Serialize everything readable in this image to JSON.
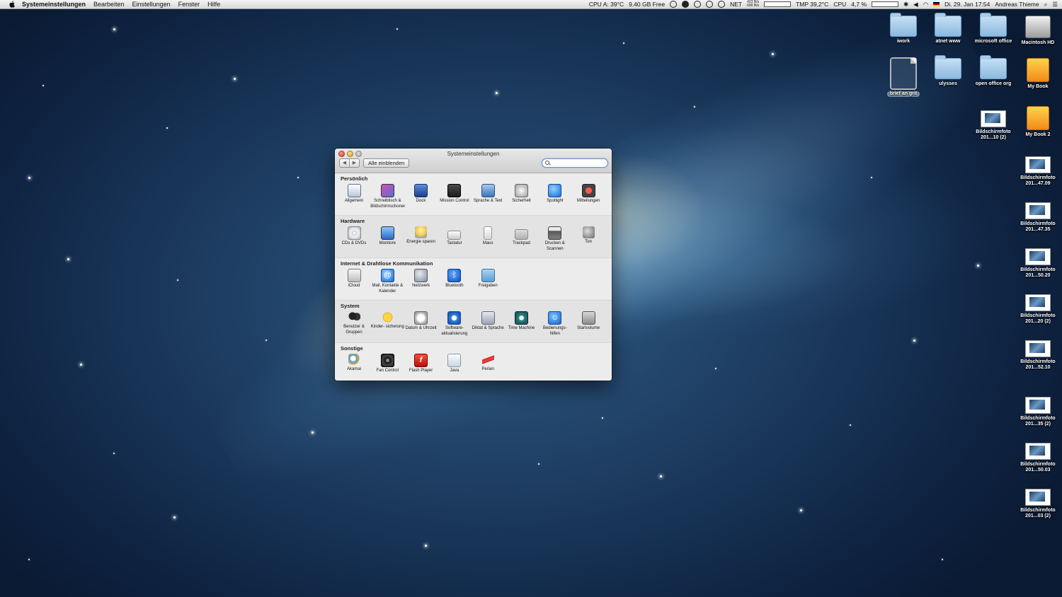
{
  "menubar": {
    "app_name": "Systemeinstellungen",
    "menus": [
      "Bearbeiten",
      "Einstellungen",
      "Fenster",
      "Hilfe"
    ],
    "status": {
      "cpu_temp": "CPU A: 39°C",
      "disk_free": "9.40 GB Free",
      "net": "NET",
      "net_up": "423 B/s",
      "net_down": "690 B/s",
      "tmp": "TMP 39,2°C",
      "cpu_label": "CPU",
      "cpu_percent": "4,7 %",
      "clock": "Di. 29. Jan  17:54",
      "user": "Andreas Thieme"
    }
  },
  "window": {
    "title": "Systemeinstellungen",
    "show_all": "Alle einblenden",
    "search_placeholder": "",
    "sections": [
      {
        "title": "Persönlich",
        "items": [
          {
            "label": "Allgemein",
            "icon": "general-icon"
          },
          {
            "label": "Schreibtisch & Bildschirmschoner",
            "icon": "desktop-icon"
          },
          {
            "label": "Dock",
            "icon": "dock-icon"
          },
          {
            "label": "Mission Control",
            "icon": "mission-control-icon"
          },
          {
            "label": "Sprache & Text",
            "icon": "language-icon"
          },
          {
            "label": "Sicherheit",
            "icon": "security-icon"
          },
          {
            "label": "Spotlight",
            "icon": "spotlight-icon"
          },
          {
            "label": "Mitteilungen",
            "icon": "notifications-icon"
          }
        ]
      },
      {
        "title": "Hardware",
        "items": [
          {
            "label": "CDs & DVDs",
            "icon": "cd-icon"
          },
          {
            "label": "Monitore",
            "icon": "monitor-icon"
          },
          {
            "label": "Energie sparen",
            "icon": "energy-icon"
          },
          {
            "label": "Tastatur",
            "icon": "keyboard-icon"
          },
          {
            "label": "Maus",
            "icon": "mouse-icon"
          },
          {
            "label": "Trackpad",
            "icon": "trackpad-icon"
          },
          {
            "label": "Drucken & Scannen",
            "icon": "printer-icon"
          },
          {
            "label": "Ton",
            "icon": "sound-icon"
          }
        ]
      },
      {
        "title": "Internet & Drahtlose Kommunikation",
        "items": [
          {
            "label": "iCloud",
            "icon": "icloud-icon"
          },
          {
            "label": "Mail, Kontakte & Kalender",
            "icon": "mail-icon"
          },
          {
            "label": "Netzwerk",
            "icon": "network-icon"
          },
          {
            "label": "Bluetooth",
            "icon": "bluetooth-icon"
          },
          {
            "label": "Freigaben",
            "icon": "sharing-icon"
          }
        ]
      },
      {
        "title": "System",
        "items": [
          {
            "label": "Benutzer & Gruppen",
            "icon": "users-icon"
          },
          {
            "label": "Kinder- sicherung",
            "icon": "parental-controls-icon"
          },
          {
            "label": "Datum & Uhrzeit",
            "icon": "clock-icon"
          },
          {
            "label": "Software- aktualisierung",
            "icon": "software-update-icon"
          },
          {
            "label": "Diktat & Sprache",
            "icon": "dictation-icon"
          },
          {
            "label": "Time Machine",
            "icon": "time-machine-icon"
          },
          {
            "label": "Bedienungs- hilfen",
            "icon": "accessibility-icon"
          },
          {
            "label": "Startvolume",
            "icon": "startup-disk-icon"
          }
        ]
      },
      {
        "title": "Sonstige",
        "items": [
          {
            "label": "Akamai",
            "icon": "akamai-icon"
          },
          {
            "label": "Fan Control",
            "icon": "fan-icon"
          },
          {
            "label": "Flash Player",
            "icon": "flash-icon"
          },
          {
            "label": "Java",
            "icon": "java-icon"
          },
          {
            "label": "Perian",
            "icon": "perian-icon"
          }
        ]
      }
    ]
  },
  "desktop_icons": [
    {
      "label": "iwork",
      "type": "folder-icon"
    },
    {
      "label": "atnet www",
      "type": "folder-icon"
    },
    {
      "label": "microsoft office",
      "type": "folder-icon"
    },
    {
      "label": "Macintosh HD",
      "type": "hard-drive-icon"
    },
    {
      "label": "brief an grit",
      "type": "document-icon",
      "selected": true
    },
    {
      "label": "ulysses",
      "type": "folder-icon"
    },
    {
      "label": "open office org",
      "type": "folder-icon"
    },
    {
      "label": "My Book",
      "type": "external-drive-icon"
    },
    {
      "label": "Bildschirmfoto 201...10 (2)",
      "type": "screenshot-icon"
    },
    {
      "label": "My Book 2",
      "type": "external-drive-icon"
    },
    {
      "label": "Bildschirmfoto 201...47.09",
      "type": "screenshot-icon"
    },
    {
      "label": "Bildschirmfoto 201...47.35",
      "type": "screenshot-icon"
    },
    {
      "label": "Bildschirmfoto 201...50.20",
      "type": "screenshot-icon"
    },
    {
      "label": "Bildschirmfoto 201...20 (2)",
      "type": "screenshot-icon"
    },
    {
      "label": "Bildschirmfoto 201...52.10",
      "type": "screenshot-icon"
    },
    {
      "label": "Bildschirmfoto 201...35 (2)",
      "type": "screenshot-icon"
    },
    {
      "label": "Bildschirmfoto 201...50.03",
      "type": "screenshot-icon"
    },
    {
      "label": "Bildschirmfoto 201...03 (2)",
      "type": "screenshot-icon"
    }
  ]
}
